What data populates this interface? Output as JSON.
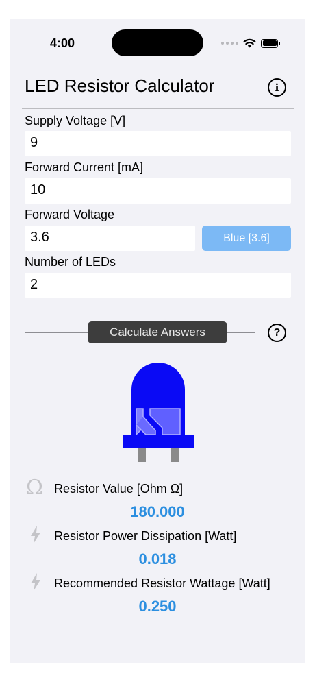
{
  "status_bar": {
    "time": "4:00"
  },
  "header": {
    "title": "LED Resistor Calculator"
  },
  "inputs": {
    "supply_voltage": {
      "label": "Supply Voltage [V]",
      "value": "9"
    },
    "forward_current": {
      "label": "Forward Current [mA]",
      "value": "10"
    },
    "forward_voltage": {
      "label": "Forward Voltage",
      "value": "3.6",
      "preset_button": "Blue [3.6]"
    },
    "num_leds": {
      "label": "Number of LEDs",
      "value": "2"
    }
  },
  "actions": {
    "calculate_label": "Calculate Answers"
  },
  "led_image": {
    "color": "#0a0af5",
    "name": "led-blue"
  },
  "results": {
    "resistor_value": {
      "label": "Resistor Value [Ohm Ω]",
      "value": "180.000",
      "icon": "omega-icon"
    },
    "power_dissipation": {
      "label": "Resistor Power Dissipation [Watt]",
      "value": "0.018",
      "icon": "bolt-icon"
    },
    "recommended_wattage": {
      "label": "Recommended Resistor Wattage [Watt]",
      "value": "0.250",
      "icon": "bolt-icon"
    }
  },
  "colors": {
    "accent": "#2c8fe0",
    "led_button": "#7cb9f5",
    "background": "#f2f2f7"
  }
}
